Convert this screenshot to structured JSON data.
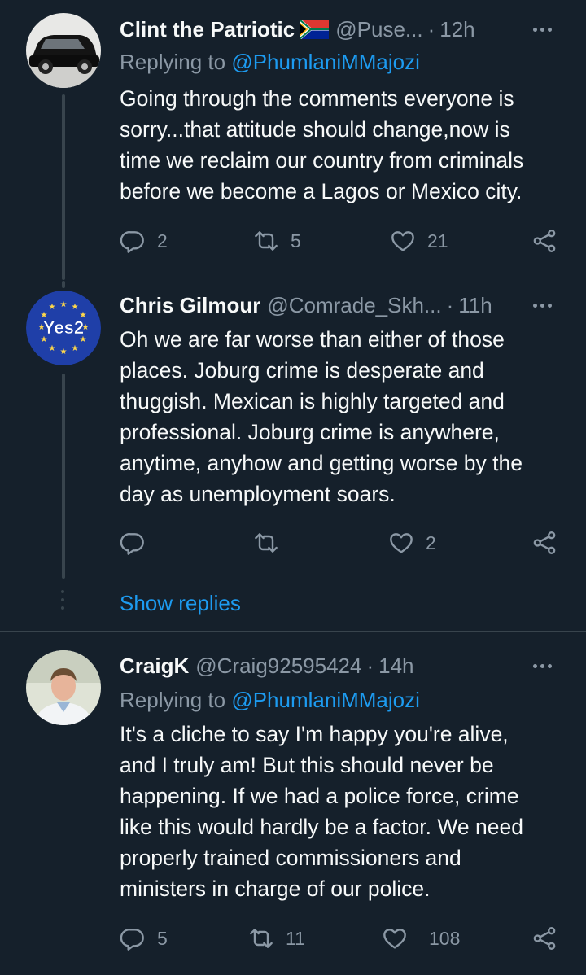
{
  "tweets": [
    {
      "name": "Clint the Patriotic",
      "handle": "@Puse...",
      "time": "12h",
      "replying_prefix": "Replying to",
      "replying_to": "@PhumlaniMMajozi",
      "lines": [
        "Going through the comments everyone is",
        "sorry...that attitude should change,now is",
        "time we reclaim our country from criminals",
        "before we become a  Lagos or Mexico city."
      ],
      "replies": "2",
      "retweets": "5",
      "likes": "21"
    },
    {
      "name": "Chris Gilmour",
      "handle": "@Comrade_Skh...",
      "time": "11h",
      "avatar_text": "Yes2",
      "lines": [
        "Oh we are far worse than either of those",
        "places. Joburg crime is desperate and",
        "thuggish. Mexican is highly targeted and",
        "professional. Joburg crime is anywhere,",
        "anytime, anyhow and getting worse by the",
        "day as unemployment soars."
      ],
      "replies": "",
      "retweets": "",
      "likes": "2"
    },
    {
      "name": "CraigK",
      "handle": "@Craig92595424",
      "time": "14h",
      "replying_prefix": "Replying to",
      "replying_to": "@PhumlaniMMajozi",
      "lines": [
        "It's a cliche to say I'm happy you're alive,",
        "and I truly am! But this should never be",
        "happening. If we had a police force, crime",
        "like this would hardly be a factor. We need",
        "properly trained commissioners and",
        "ministers in charge of our police."
      ],
      "replies": "5",
      "retweets": "11",
      "likes": "108"
    }
  ],
  "show_replies": "Show replies",
  "colors": {
    "background": "#15202b",
    "text": "#f7f9f9",
    "secondary": "#8b98a5",
    "accent": "#1d9bf0",
    "line": "#38444d"
  },
  "icons": [
    "reply-icon",
    "retweet-icon",
    "like-icon",
    "share-icon",
    "more-icon",
    "south-africa-flag-icon"
  ]
}
